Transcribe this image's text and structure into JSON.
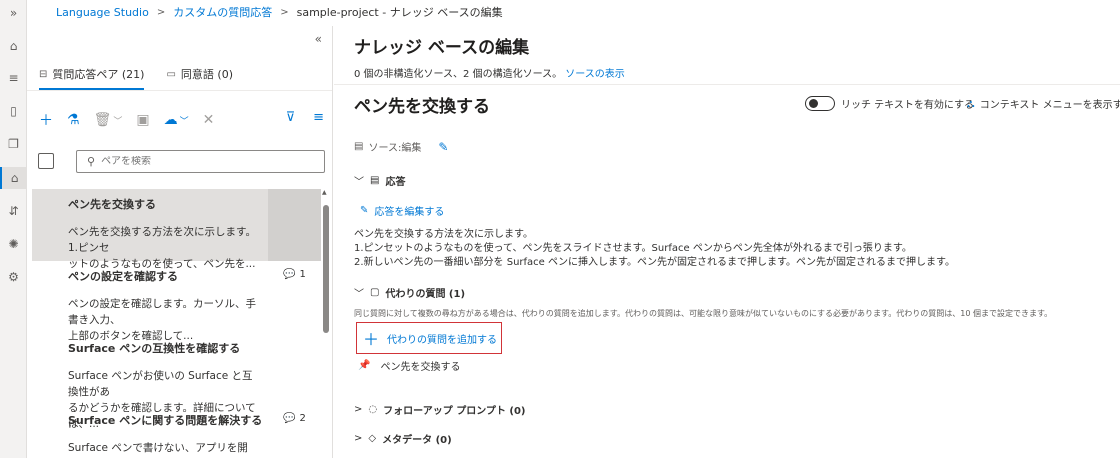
{
  "rail": {
    "items": [
      {
        "icon": "expand-icon",
        "glyph": "»"
      },
      {
        "icon": "home-icon",
        "glyph": "⌂"
      },
      {
        "icon": "list-icon",
        "glyph": "≡"
      },
      {
        "icon": "storage-icon",
        "glyph": "▯"
      },
      {
        "icon": "knowledge-icon",
        "glyph": "❐"
      },
      {
        "icon": "edit-kb-icon",
        "glyph": "⌂"
      },
      {
        "icon": "deploy-icon",
        "glyph": "⇵"
      },
      {
        "icon": "bulb-icon",
        "glyph": "✺"
      },
      {
        "icon": "settings-icon",
        "glyph": "⚙"
      }
    ]
  },
  "breadcrumb": {
    "root": "Language Studio",
    "section": "カスタムの質問応答",
    "current": "sample-project - ナレッジ ベースの編集"
  },
  "left": {
    "tabs": [
      {
        "label": "質問応答ペア (21)",
        "icon": "qa-pairs-icon"
      },
      {
        "label": "同意語 (0)",
        "icon": "synonyms-icon"
      }
    ],
    "search_placeholder": "ペアを検索",
    "qa_pairs": [
      {
        "title": "ペン先を交換する",
        "desc1": "ペン先を交換する方法を次に示します。1.ピンセ",
        "desc2": "ットのようなものを使って、ペン先を...",
        "count": ""
      },
      {
        "title": "ペンの設定を確認する",
        "desc1": "ペンの設定を確認します。カーソル、手書き入力、",
        "desc2": "上部のボタンを確認して...",
        "count": "1"
      },
      {
        "title": "Surface ペンの互換性を確認する",
        "desc1": "Surface ペンがお使いの Surface と互換性があ",
        "desc2": "るかどうかを確認します。詳細については、...",
        "count": ""
      },
      {
        "title": "Surface ペンに関する問題を解決する",
        "desc1": "Surface ペンで書けない、アプリを開けない、",
        "desc2": "",
        "count": "2"
      }
    ]
  },
  "right": {
    "kb_title": "ナレッジ ベースの編集",
    "kb_subtitle": "0 個の非構造化ソース、2 個の構造化ソース。",
    "kb_subtitle_link": "ソースの表示",
    "question_title": "ペン先を交換する",
    "rich_text_label": "リッチ テキストを有効にする",
    "rich_text_enabled": false,
    "context_menu_label": "コンテキスト メニューを表示する",
    "source_label": "ソース:編集",
    "answer_heading": "応答",
    "edit_answer_label": "応答を編集する",
    "answer_lines": [
      "ペン先を交換する方法を次に示します。",
      "1.ピンセットのようなものを使って、ペン先をスライドさせます。Surface ペンからペン先全体が外れるまで引っ張ります。",
      "2.新しいペン先の一番細い部分を Surface ペンに挿入します。ペン先が固定されるまで押します。ペン先が固定されるまで押します。"
    ],
    "alt_heading": "代わりの質問 (1)",
    "alt_note": "同じ質問に対して複数の尋ね方がある場合は、代わりの質問を追加します。代わりの質問は、可能な限り意味が似ていないものにする必要があります。代わりの質問は、10 個まで設定できます。",
    "add_alt_label": "代わりの質問を追加する",
    "alt_questions": [
      "ペン先を交換する"
    ],
    "followup_heading": "フォローアップ プロンプト (0)",
    "metadata_heading": "メタデータ (0)"
  },
  "colors": {
    "accent": "#0078d4",
    "highlight_border": "#d13438",
    "selected_bg": "#e1dfdd"
  }
}
